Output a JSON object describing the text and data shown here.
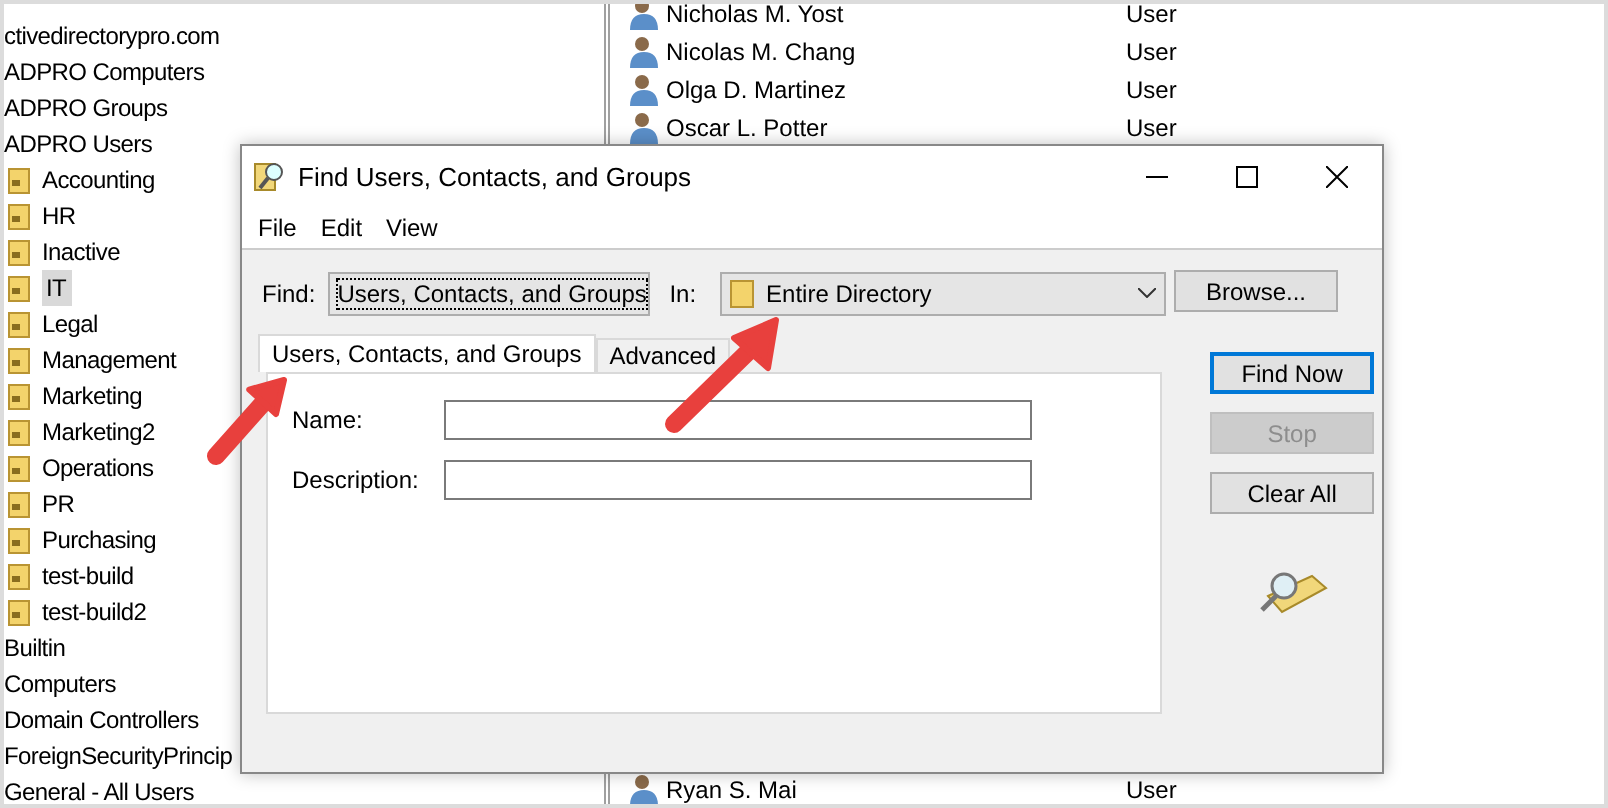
{
  "tree": {
    "items": [
      {
        "label": "ctivedirectorypro.com",
        "selected": false,
        "children": [
          {
            "label": "ADPRO Computers",
            "selected": false
          },
          {
            "label": "ADPRO Groups",
            "selected": false
          },
          {
            "label": "ADPRO Users",
            "selected": false,
            "children": [
              {
                "label": "Accounting",
                "selected": false
              },
              {
                "label": "HR",
                "selected": false
              },
              {
                "label": "Inactive",
                "selected": false
              },
              {
                "label": "IT",
                "selected": true
              },
              {
                "label": "Legal",
                "selected": false
              },
              {
                "label": "Management",
                "selected": false
              },
              {
                "label": "Marketing",
                "selected": false
              },
              {
                "label": "Marketing2",
                "selected": false
              },
              {
                "label": "Operations",
                "selected": false
              },
              {
                "label": "PR",
                "selected": false
              },
              {
                "label": "Purchasing",
                "selected": false
              },
              {
                "label": "test-build",
                "selected": false
              },
              {
                "label": "test-build2",
                "selected": false
              }
            ]
          },
          {
            "label": "Builtin",
            "selected": false
          },
          {
            "label": "Computers",
            "selected": false
          },
          {
            "label": "Domain Controllers",
            "selected": false
          },
          {
            "label": "ForeignSecurityPrincip",
            "selected": false
          },
          {
            "label": "General - All Users",
            "selected": false
          }
        ]
      }
    ]
  },
  "list": {
    "rows_top": [
      {
        "name": "Nicholas M. Yost",
        "type": "User"
      },
      {
        "name": "Nicolas M. Chang",
        "type": "User"
      },
      {
        "name": "Olga D. Martinez",
        "type": "User"
      },
      {
        "name": "Oscar L. Potter",
        "type": "User"
      }
    ],
    "rows_bottom": [
      {
        "name": "Ryan S. Mai",
        "type": "User"
      }
    ]
  },
  "dialog": {
    "title": "Find Users, Contacts, and Groups",
    "menu": [
      "File",
      "Edit",
      "View"
    ],
    "find_label": "Find:",
    "find_value": "Users, Contacts, and Groups",
    "find_focused": true,
    "in_label": "In:",
    "in_value": "Entire Directory",
    "browse": "Browse...",
    "tabs": [
      {
        "label": "Users, Contacts, and Groups",
        "selected": true
      },
      {
        "label": "Advanced",
        "selected": false
      }
    ],
    "fields": [
      {
        "label": "Name:"
      },
      {
        "label": "Description:"
      }
    ],
    "buttons": [
      {
        "label": "Find Now",
        "default": true,
        "disabled": false
      },
      {
        "label": "Stop",
        "default": false,
        "disabled": true
      },
      {
        "label": "Clear All",
        "default": false,
        "disabled": false
      }
    ]
  }
}
